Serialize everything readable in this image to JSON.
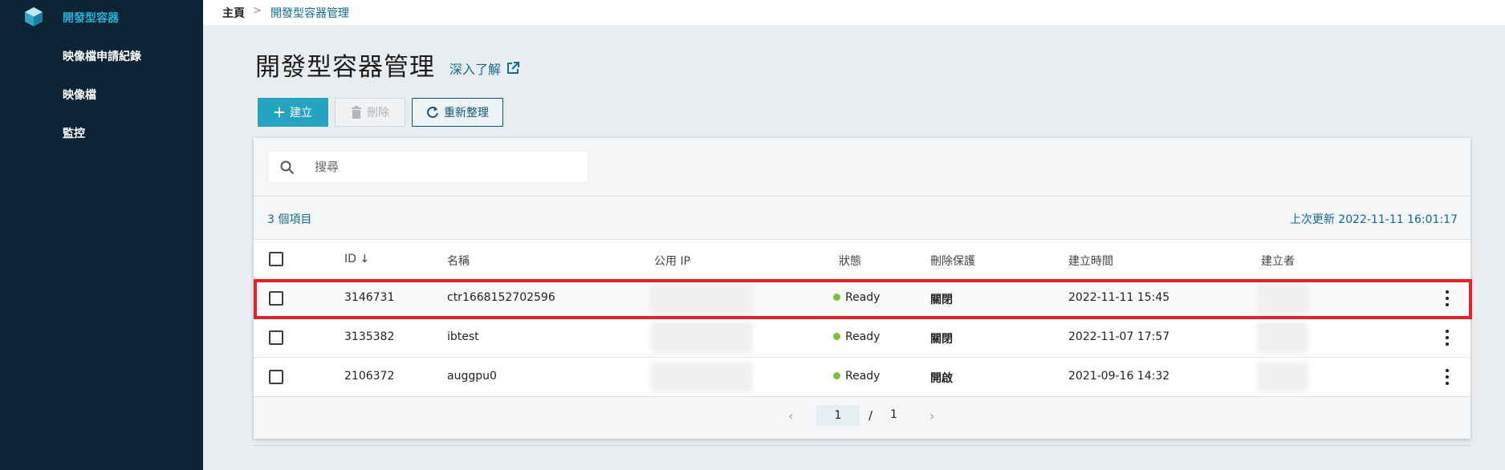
{
  "sidebar": {
    "items": [
      {
        "label": "開發型容器",
        "active": true
      },
      {
        "label": "映像檔申請紀錄"
      },
      {
        "label": "映像檔"
      },
      {
        "label": "監控"
      }
    ]
  },
  "breadcrumb": {
    "home": "主頁",
    "separator": ">",
    "current": "開發型容器管理"
  },
  "page": {
    "title": "開發型容器管理",
    "learn_more": "深入了解"
  },
  "toolbar": {
    "create_label": "建立",
    "delete_label": "刪除",
    "refresh_label": "重新整理"
  },
  "search": {
    "placeholder": "搜尋",
    "value": ""
  },
  "summary": {
    "item_count": "3 個項目",
    "last_update": "上次更新 2022-11-11 16:01:17"
  },
  "table": {
    "columns": {
      "id": "ID",
      "name": "名稱",
      "public_ip": "公用 IP",
      "status": "狀態",
      "delete_protection": "刪除保護",
      "created_time": "建立時間",
      "creator": "建立者"
    },
    "sort_indicator": "↓",
    "rows": [
      {
        "id": "3146731",
        "name": "ctr1668152702596",
        "status": "Ready",
        "delete_protection": "關閉",
        "created_time": "2022-11-11 15:45",
        "highlighted": true
      },
      {
        "id": "3135382",
        "name": "ibtest",
        "status": "Ready",
        "delete_protection": "關閉",
        "created_time": "2022-11-07 17:57"
      },
      {
        "id": "2106372",
        "name": "auggpu0",
        "status": "Ready",
        "delete_protection": "開啟",
        "created_time": "2021-09-16 14:32"
      }
    ]
  },
  "pagination": {
    "prev": "‹",
    "current": "1",
    "separator": "/",
    "total": "1",
    "next": "›"
  },
  "colors": {
    "accent": "#25a4c2",
    "sidebar_bg": "#0d2336",
    "link": "#0c6e8d",
    "status_ready": "#79c23a",
    "highlight_box": "#e32229"
  }
}
